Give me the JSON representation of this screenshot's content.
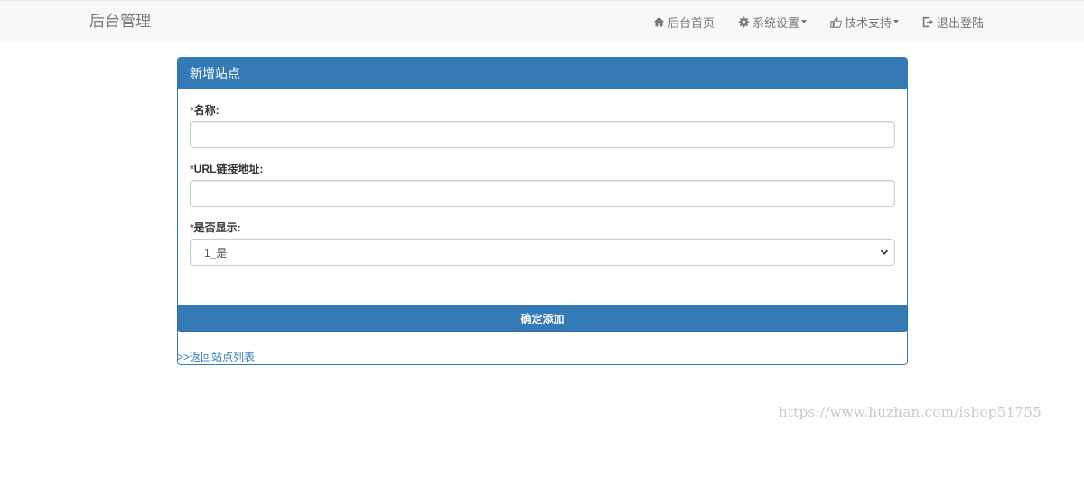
{
  "navbar": {
    "brand": "后台管理",
    "items": [
      {
        "label": "后台首页",
        "icon": "home-icon",
        "dropdown": false
      },
      {
        "label": "系统设置",
        "icon": "gear-icon",
        "dropdown": true
      },
      {
        "label": "技术支持",
        "icon": "thumbs-up-icon",
        "dropdown": true
      },
      {
        "label": "退出登陆",
        "icon": "logout-icon",
        "dropdown": false
      }
    ]
  },
  "panel": {
    "title": "新增站点",
    "fields": {
      "name": {
        "required_mark": "*",
        "label": "名称:",
        "value": "",
        "placeholder": ""
      },
      "url": {
        "required_mark": "*",
        "label": "URL链接地址:",
        "value": "",
        "placeholder": ""
      },
      "display": {
        "required_mark": "*",
        "label": "是否显示:",
        "selected": "1_是"
      }
    },
    "submit_label": "确定添加",
    "back_link": ">>返回站点列表"
  },
  "watermark": "https://www.huzhan.com/ishop51755",
  "colors": {
    "primary": "#337ab7",
    "navbar_bg": "#f8f8f8",
    "nav_text": "#777777",
    "required": "#a94442"
  }
}
